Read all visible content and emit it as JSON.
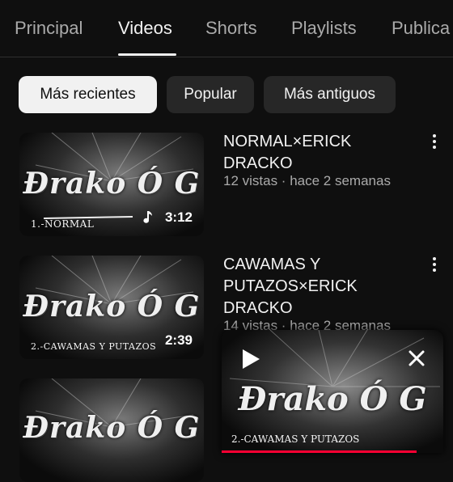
{
  "tabs": [
    "Principal",
    "Videos",
    "Shorts",
    "Playlists",
    "Publica"
  ],
  "filters": [
    "Más recientes",
    "Popular",
    "Más antiguos"
  ],
  "videos": [
    {
      "title_lines": [
        "NORMAL×ERICK",
        "DRACKO"
      ],
      "meta": "12 vistas · hace 2 semanas",
      "duration": "3:12",
      "thumb_logo": "Ðrako Ó G",
      "thumb_caption": "1.-NORMAL"
    },
    {
      "title_lines": [
        "CAWAMAS Y",
        "PUTAZOS×ERICK",
        "DRACKO"
      ],
      "meta": "14 vistas · hace 2 semanas",
      "duration": "2:39",
      "thumb_logo": "Ðrako Ó G",
      "thumb_caption": "2.-CAWAMAS Y PUTAZOS"
    },
    {
      "thumb_logo": "Ðrako Ó G"
    }
  ],
  "miniplayer": {
    "logo": "Ðrako Ó G",
    "caption": "2.-CAWAMAS Y PUTAZOS",
    "progress": 0.88
  },
  "colors": {
    "background": "#0f0f0f",
    "progress": "#ff0033",
    "chip_active": "#f1f1f1",
    "chip": "#272727"
  }
}
